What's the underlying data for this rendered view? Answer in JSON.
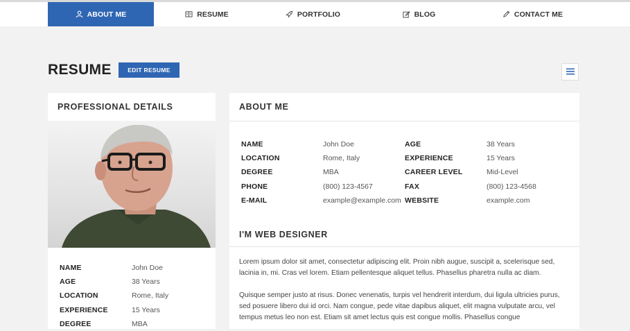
{
  "nav": {
    "items": [
      {
        "label": "ABOUT ME",
        "icon": "user-icon",
        "active": true
      },
      {
        "label": "RESUME",
        "icon": "book-icon",
        "active": false
      },
      {
        "label": "PORTFOLIO",
        "icon": "rocket-icon",
        "active": false
      },
      {
        "label": "BLOG",
        "icon": "edit-square-icon",
        "active": false
      },
      {
        "label": "CONTACT ME",
        "icon": "pencil-icon",
        "active": false
      }
    ]
  },
  "page": {
    "title": "RESUME",
    "edit_label": "EDIT RESUME",
    "menu_icon": "hamburger-icon"
  },
  "professional": {
    "heading": "PROFESSIONAL DETAILS",
    "details": [
      {
        "label": "NAME",
        "value": "John Doe"
      },
      {
        "label": "AGE",
        "value": "38 Years"
      },
      {
        "label": "LOCATION",
        "value": "Rome, Italy"
      },
      {
        "label": "EXPERIENCE",
        "value": "15 Years"
      },
      {
        "label": "DEGREE",
        "value": "MBA"
      }
    ]
  },
  "about": {
    "heading": "ABOUT ME",
    "rows": [
      {
        "l1": "NAME",
        "v1": "John Doe",
        "l2": "AGE",
        "v2": "38 Years"
      },
      {
        "l1": "LOCATION",
        "v1": "Rome, Italy",
        "l2": "EXPERIENCE",
        "v2": "15 Years"
      },
      {
        "l1": "DEGREE",
        "v1": "MBA",
        "l2": "CAREER LEVEL",
        "v2": "Mid-Level"
      },
      {
        "l1": "PHONE",
        "v1": "(800) 123-4567",
        "l2": "FAX",
        "v2": "(800) 123-4568"
      },
      {
        "l1": "E-MAIL",
        "v1": "example@example.com",
        "l2": "WEBSITE",
        "v2": "example.com"
      }
    ],
    "sub_heading": "I'M WEB DESIGNER",
    "paragraph1": "Lorem ipsum dolor sit amet, consectetur adipiscing elit. Proin nibh augue, suscipit a, scelerisque sed, lacinia in, mi. Cras vel lorem. Etiam pellentesque aliquet tellus. Phasellus pharetra nulla ac diam.",
    "paragraph2": "Quisque semper justo at risus. Donec venenatis, turpis vel hendrerit interdum, dui ligula ultricies purus, sed posuere libero dui id orci. Nam congue, pede vitae dapibus aliquet, elit magna vulputate arcu, vel tempus metus leo non est. Etiam sit amet lectus quis est congue mollis. Phasellus congue"
  },
  "colors": {
    "accent": "#2f66b3",
    "background": "#f2f2f2",
    "card": "#ffffff"
  }
}
